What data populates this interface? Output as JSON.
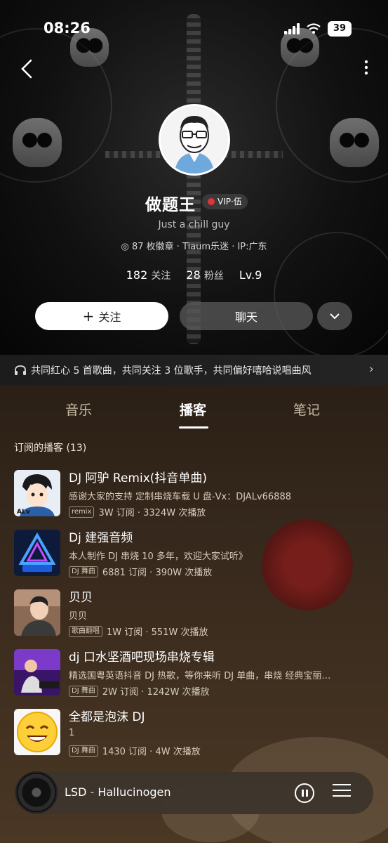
{
  "status_bar": {
    "time": "08:26",
    "battery": "39"
  },
  "profile": {
    "nickname": "做题王",
    "vip_label": "VIP·伍",
    "signature": "Just a chill guy",
    "meta": "87 枚徽章 · Tiaum乐迷 · IP:广东",
    "stats": [
      {
        "value": "182",
        "label": "关注"
      },
      {
        "value": "28",
        "label": "粉丝"
      },
      {
        "value": "Lv.9",
        "label": ""
      }
    ],
    "follow_label": "关注",
    "chat_label": "聊天"
  },
  "common_banner": "共同红心 5 首歌曲，共同关注 3 位歌手，共同偏好嘻哈说唱曲风",
  "tabs": [
    {
      "label": "音乐",
      "active": false
    },
    {
      "label": "播客",
      "active": true
    },
    {
      "label": "笔记",
      "active": false
    }
  ],
  "section_title": "订阅的播客 (13)",
  "podcasts": [
    {
      "title": "DJ 阿驴 Remix(抖音单曲)",
      "desc": "感谢大家的支持 定制串烧车载 U 盘-Vx：DJALv66888",
      "tag": "remix",
      "stats": "3W 订阅 · 3324W 次播放"
    },
    {
      "title": "Dj 建强音频",
      "desc": "本人制作 DJ 串烧 10 多年，欢迎大家试听》",
      "tag": "DJ 舞曲",
      "stats": "6881 订阅 · 390W 次播放"
    },
    {
      "title": "贝贝",
      "desc": "贝贝",
      "tag": "歌曲翻唱",
      "stats": "1W 订阅 · 551W 次播放"
    },
    {
      "title": "dj 口水坚酒吧现场串烧专辑",
      "desc": "精选国粤英语抖音 DJ 热歌，等你来听 DJ 单曲，串烧 经典宝丽…",
      "tag": "DJ 舞曲",
      "stats": "2W 订阅 · 1242W 次播放"
    },
    {
      "title": "全都是泡沫 DJ",
      "desc": "1",
      "tag": "DJ 舞曲",
      "stats": "1430 订阅 · 4W 次播放"
    }
  ],
  "player": {
    "track": "LSD",
    "artist": "Hallucinogen"
  },
  "colors": {
    "accent_red": "#e0333c",
    "content_bg": "#3a2b1e"
  }
}
